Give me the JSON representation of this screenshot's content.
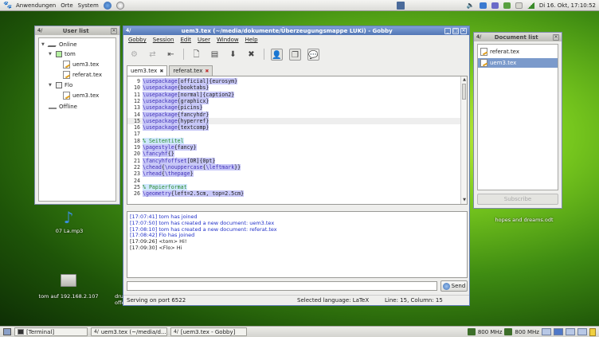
{
  "top_panel": {
    "menus": [
      "Anwendungen",
      "Orte",
      "System"
    ],
    "clock": "Di 16. Okt, 17:10:52"
  },
  "user_list": {
    "title": "User list",
    "online_label": "Online",
    "offline_label": "Offline",
    "users": [
      {
        "name": "tom",
        "color": "#b4f0a0",
        "docs": [
          "uem3.tex",
          "referat.tex"
        ]
      },
      {
        "name": "Flo",
        "color": "#f0f0f0",
        "docs": [
          "uem3.tex"
        ]
      }
    ]
  },
  "document_list": {
    "title": "Document list",
    "items": [
      "referat.tex",
      "uem3.tex"
    ],
    "selected": 1,
    "subscribe_label": "Subscribe"
  },
  "gobby": {
    "title": "uem3.tex (~/media/dokumente/Überzeugungsmappe LUKi) - Gobby",
    "menu": [
      "Gobby",
      "Session",
      "Edit",
      "User",
      "Window",
      "Help"
    ],
    "tabs": [
      {
        "label": "uem3.tex",
        "close": "✖",
        "active": true
      },
      {
        "label": "referat.tex",
        "close": "✖",
        "active": false
      }
    ],
    "code": [
      {
        "n": "9",
        "parts": [
          [
            "cmd",
            "\\usepackage"
          ],
          [
            "brace",
            "[official]{eurosym}"
          ]
        ]
      },
      {
        "n": "10",
        "parts": [
          [
            "cmd",
            "\\usepackage"
          ],
          [
            "brace",
            "{booktabs}"
          ]
        ]
      },
      {
        "n": "11",
        "parts": [
          [
            "cmd",
            "\\usepackage"
          ],
          [
            "brace",
            "[normal]{caption2}"
          ]
        ]
      },
      {
        "n": "12",
        "parts": [
          [
            "cmd",
            "\\usepackage"
          ],
          [
            "brace",
            "{graphicx}"
          ]
        ]
      },
      {
        "n": "13",
        "parts": [
          [
            "cmd",
            "\\usepackage"
          ],
          [
            "brace",
            "{picins}"
          ]
        ]
      },
      {
        "n": "14",
        "parts": [
          [
            "cmd",
            "\\usepackage"
          ],
          [
            "brace",
            "{fancyhdr}"
          ]
        ]
      },
      {
        "n": "15",
        "parts": [
          [
            "cmd",
            "\\usepackage"
          ],
          [
            "brace",
            "{hyperref}"
          ]
        ],
        "current": true
      },
      {
        "n": "16",
        "parts": [
          [
            "cmd",
            "\\usepackage"
          ],
          [
            "brace",
            "{textcomp}"
          ]
        ]
      },
      {
        "n": "17",
        "parts": []
      },
      {
        "n": "18",
        "parts": [
          [
            "cmt",
            "% Seitentitel"
          ]
        ]
      },
      {
        "n": "19",
        "parts": [
          [
            "cmd",
            "\\pagestyle"
          ],
          [
            "brace",
            "{fancy}"
          ]
        ]
      },
      {
        "n": "20",
        "parts": [
          [
            "cmd",
            "\\fancyhf"
          ],
          [
            "brace",
            "{}"
          ]
        ]
      },
      {
        "n": "21",
        "parts": [
          [
            "cmd",
            "\\fancyhfoffset"
          ],
          [
            "brace",
            "[OR]{0pt}"
          ]
        ]
      },
      {
        "n": "22",
        "parts": [
          [
            "cmd",
            "\\chead"
          ],
          [
            "brace",
            "{"
          ],
          [
            "cmd",
            "\\nouppercase"
          ],
          [
            "brace",
            "{"
          ],
          [
            "cmd",
            "\\leftmark"
          ],
          [
            "brace",
            "}}"
          ]
        ]
      },
      {
        "n": "23",
        "parts": [
          [
            "cmd",
            "\\rhead"
          ],
          [
            "brace",
            "{"
          ],
          [
            "cmd",
            "\\thepage"
          ],
          [
            "brace",
            "}"
          ]
        ]
      },
      {
        "n": "24",
        "parts": []
      },
      {
        "n": "25",
        "parts": [
          [
            "cmt",
            "% Papierformat"
          ]
        ]
      },
      {
        "n": "26",
        "parts": [
          [
            "cmd",
            "\\geometry"
          ],
          [
            "brace",
            "{left=2.5cm, top=2.5cm}"
          ]
        ]
      }
    ],
    "chat": [
      "[17:07:41] tom has joined",
      "[17:07:50] tom has created a new document: uem3.tex",
      "[17:08:10] tom has created a new document: referat.tex",
      "[17:08:42] Flo has joined",
      "[17:09:26] <tom> Hi!",
      "[17:09:30] <Flo> Hi"
    ],
    "send_label": "Send",
    "status": {
      "left": "Serving on port 6522",
      "language": "Selected language: LaTeX",
      "position": "Line: 15, Column: 15"
    }
  },
  "desktop_icons": [
    {
      "label": "07 La.mp3"
    },
    {
      "label": "tom auf 192.168.2.107"
    },
    {
      "label": "hopes and dreams.odt"
    }
  ],
  "hidden_text": {
    "drug": "drud",
    "offen": "offen"
  },
  "taskbar": {
    "tasks": [
      "[Terminal]",
      "uem3.tex (~/media/d...",
      "[uem3.tex - Gobby]"
    ],
    "cpu1": "800 MHz",
    "cpu2": "800 MHz"
  }
}
